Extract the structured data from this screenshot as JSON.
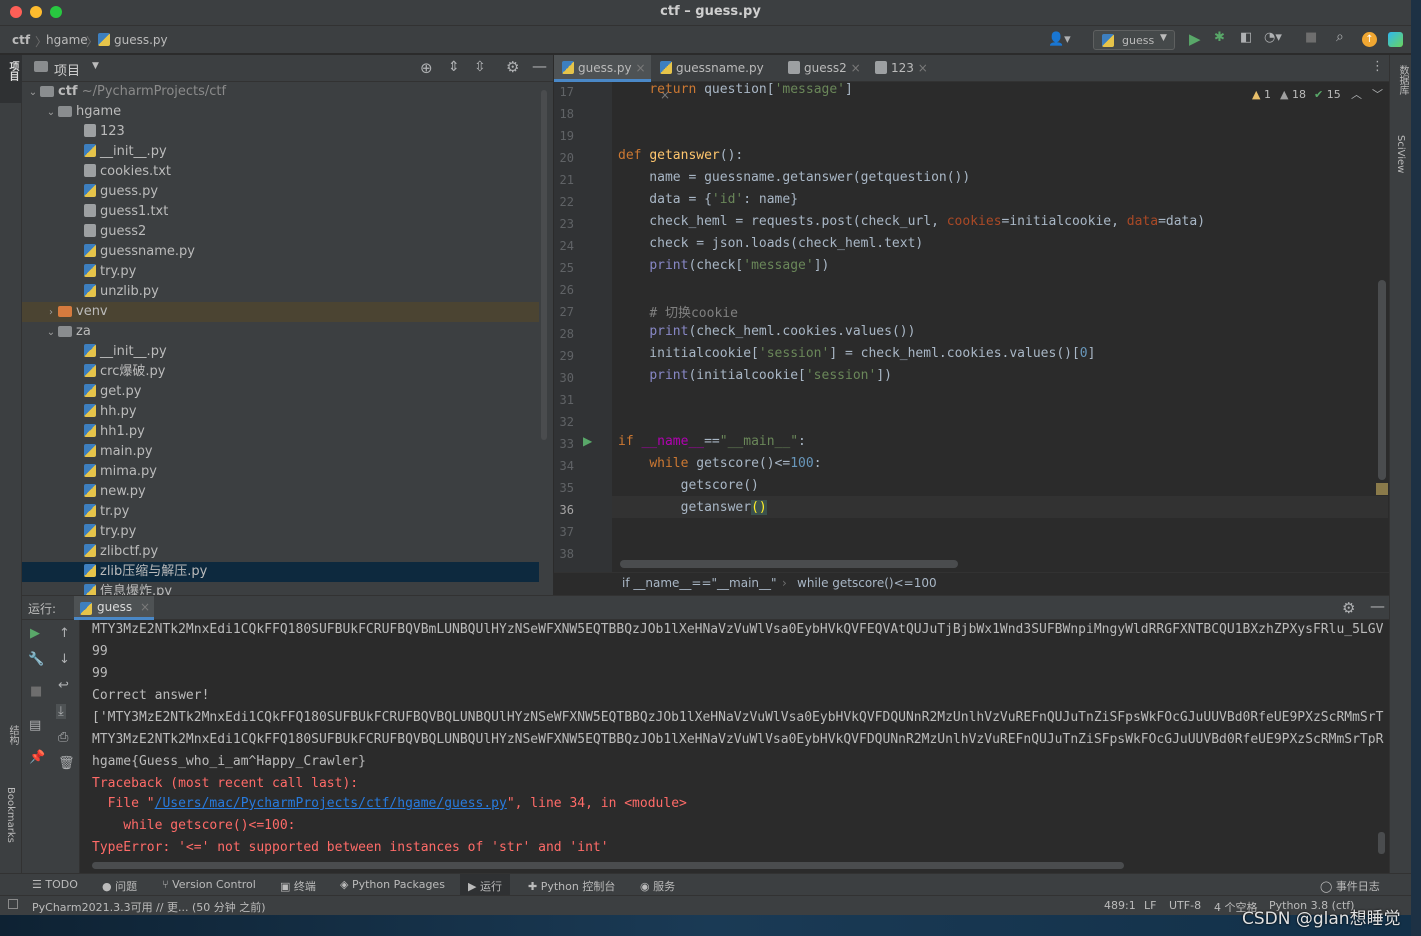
{
  "window": {
    "title": "ctf – guess.py"
  },
  "nav": {
    "crumbs": [
      "ctf",
      "hgame",
      "guess.py"
    ],
    "user_icon": "user-icon",
    "run_config": "guess"
  },
  "left_strip": {
    "project_label": "项目",
    "structure_label": "结构",
    "bookmarks_label": "Bookmarks"
  },
  "right_strip": {
    "database_label": "数据库",
    "sciview_label": "SciView"
  },
  "project": {
    "title": "项目",
    "root_name": "ctf",
    "root_path": "~/PycharmProjects/ctf",
    "tree": [
      {
        "name": "hgame",
        "type": "dir",
        "depth": 1,
        "expanded": true
      },
      {
        "name": "123",
        "type": "txt",
        "depth": 2
      },
      {
        "name": "__init__.py",
        "type": "py",
        "depth": 2
      },
      {
        "name": "cookies.txt",
        "type": "txt",
        "depth": 2
      },
      {
        "name": "guess.py",
        "type": "py",
        "depth": 2
      },
      {
        "name": "guess1.txt",
        "type": "txt",
        "depth": 2
      },
      {
        "name": "guess2",
        "type": "txt",
        "depth": 2
      },
      {
        "name": "guessname.py",
        "type": "py",
        "depth": 2
      },
      {
        "name": "try.py",
        "type": "py",
        "depth": 2
      },
      {
        "name": "unzlib.py",
        "type": "py",
        "depth": 2
      },
      {
        "name": "venv",
        "type": "venv",
        "depth": 1,
        "expanded": false
      },
      {
        "name": "za",
        "type": "dir",
        "depth": 1,
        "expanded": true
      },
      {
        "name": "__init__.py",
        "type": "py",
        "depth": 2
      },
      {
        "name": "crc爆破.py",
        "type": "py",
        "depth": 2
      },
      {
        "name": "get.py",
        "type": "py",
        "depth": 2
      },
      {
        "name": "hh.py",
        "type": "py",
        "depth": 2
      },
      {
        "name": "hh1.py",
        "type": "py",
        "depth": 2
      },
      {
        "name": "main.py",
        "type": "py",
        "depth": 2
      },
      {
        "name": "mima.py",
        "type": "py",
        "depth": 2
      },
      {
        "name": "new.py",
        "type": "py",
        "depth": 2
      },
      {
        "name": "tr.py",
        "type": "py",
        "depth": 2
      },
      {
        "name": "try.py",
        "type": "py",
        "depth": 2
      },
      {
        "name": "zlibctf.py",
        "type": "py",
        "depth": 2
      },
      {
        "name": "zlib压缩与解压.py",
        "type": "py",
        "depth": 2,
        "selected": true
      },
      {
        "name": "信息爆炸.py",
        "type": "py",
        "depth": 2
      }
    ]
  },
  "editor": {
    "tabs": [
      {
        "label": "guess.py",
        "active": true
      },
      {
        "label": "guessname.py",
        "active": false
      },
      {
        "label": "guess2",
        "active": false
      },
      {
        "label": "123",
        "active": false
      }
    ],
    "inspections": {
      "warnings": "1",
      "weak_warnings": "18",
      "ok": "15"
    },
    "line_numbers": [
      "17",
      "18",
      "19",
      "20",
      "21",
      "22",
      "23",
      "24",
      "25",
      "26",
      "27",
      "28",
      "29",
      "30",
      "31",
      "32",
      "33",
      "34",
      "35",
      "36",
      "37",
      "38"
    ],
    "current_line": "36",
    "breadcrumb": [
      "if __name__==\"__main__\"",
      "while getscore()<=100"
    ]
  },
  "run": {
    "label": "运行:",
    "tab": "guess",
    "output": [
      {
        "text": "MTY3MzE2NTk2MnxEdi1CQkFFQ180SUFBUkFCRUFBQVBmLUNBQUlHYzNSeWFXNW5EQTBBQzJOb1lXeHNaVzVuWlVsa0EybHVkQVFEQVAtQUJuTjBjbWx1Wnd3SUFBWnpiMngyWldRRGFXNTBCQU1BXzhZPXysFRlu_5LGV",
        "err": false
      },
      {
        "text": "99",
        "err": false
      },
      {
        "text": "99",
        "err": false
      },
      {
        "text": "Correct answer!",
        "err": false
      },
      {
        "text": "['MTY3MzE2NTk2MnxEdi1CQkFFQ180SUFBUkFCRUFBQVBQLUNBQUlHYzNSeWFXNW5EQTBBQzJOb1lXeHNaVzVuWlVsa0EybHVkQVFDQUNnR2MzUnlhVzVuREFnQUJuTnZiSFpsWkFOcGJuUUVBd0RfeUE9PXzScRMmSrT",
        "err": false
      },
      {
        "text": "MTY3MzE2NTk2MnxEdi1CQkFFQ180SUFBUkFCRUFBQVBQLUNBQUlHYzNSeWFXNW5EQTBBQzJOb1lXeHNaVzVuWlVsa0EybHVkQVFDQUNnR2MzUnlhVzVuREFnQUJuTnZiSFpsWkFOcGJuUUVBd0RfeUE9PXzScRMmSrTpR",
        "err": false
      },
      {
        "text": "hgame{Guess_who_i_am^Happy_Crawler}",
        "err": false
      },
      {
        "text": "Traceback (most recent call last):",
        "err": true
      }
    ],
    "tb_file_prefix": "  File \"",
    "tb_file_link": "/Users/mac/PycharmProjects/ctf/hgame/guess.py",
    "tb_file_suffix": "\", line 34, in <module>",
    "tb_code": "    while getscore()<=100:",
    "tb_error": "TypeError: '<=' not supported between instances of 'str' and 'int'"
  },
  "bottom_tabs": [
    "TODO",
    "问题",
    "Version Control",
    "终端",
    "Python Packages",
    "运行",
    "Python 控制台",
    "服务",
    "事件日志"
  ],
  "status": {
    "message": "PyCharm2021.3.3可用 // 更... (50 分钟 之前)",
    "position": "489:1",
    "line_sep": "LF",
    "encoding": "UTF-8",
    "indent": "4 个空格",
    "interpreter": "Python 3.8 (ctf)"
  },
  "watermark": "CSDN @glan想睡觉"
}
